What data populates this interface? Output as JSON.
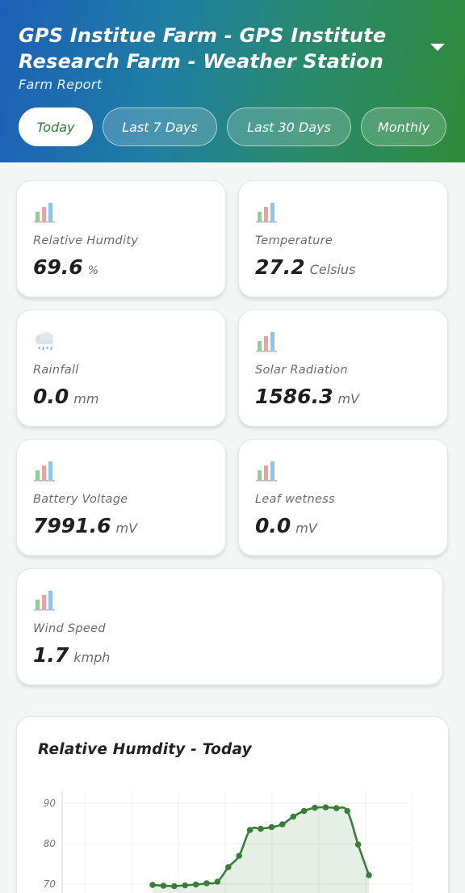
{
  "header": {
    "title": "GPS Institue Farm - GPS Institute Research Farm - Weather Station",
    "subtitle": "Farm Report",
    "dropdown_icon": "caret-down-icon"
  },
  "tabs": [
    {
      "label": "Today",
      "active": true
    },
    {
      "label": "Last 7 Days",
      "active": false
    },
    {
      "label": "Last 30 Days",
      "active": false
    },
    {
      "label": "Monthly",
      "active": false
    }
  ],
  "metrics": {
    "humidity": {
      "label": "Relative Humdity",
      "value": "69.6",
      "unit": "%",
      "icon": "bar-chart-icon"
    },
    "temperature": {
      "label": "Temperature",
      "value": "27.2",
      "unit": "Celsius",
      "icon": "bar-chart-icon"
    },
    "rainfall": {
      "label": "Rainfall",
      "value": "0.0",
      "unit": "mm",
      "icon": "rain-cloud-icon"
    },
    "solar": {
      "label": "Solar Radiation",
      "value": "1586.3",
      "unit": "mV",
      "icon": "bar-chart-icon"
    },
    "battery": {
      "label": "Battery Voltage",
      "value": "7991.6",
      "unit": "mV",
      "icon": "bar-chart-icon"
    },
    "leaf": {
      "label": "Leaf wetness",
      "value": "0.0",
      "unit": "mV",
      "icon": "bar-chart-icon"
    },
    "wind": {
      "label": "Wind Speed",
      "value": "1.7",
      "unit": "kmph",
      "icon": "bar-chart-icon"
    }
  },
  "colors": {
    "accent_green": "#2e7d32",
    "header_blue": "#1c5fb8",
    "header_green": "#2e8b3a"
  },
  "chart_data": {
    "type": "line",
    "title": "Relative Humdity - Today",
    "xlabel": "",
    "ylabel": "",
    "yticks": [
      70,
      80,
      90
    ],
    "ylim": [
      66,
      93
    ],
    "x": [
      0,
      1,
      2,
      3,
      4,
      5,
      6,
      7,
      8,
      9,
      10,
      11,
      12,
      13,
      14,
      15,
      16,
      17,
      18,
      19,
      20
    ],
    "series": [
      {
        "values": [
          69.8,
          69.6,
          69.5,
          69.7,
          69.9,
          70.2,
          70.6,
          74.2,
          77.0,
          83.4,
          83.7,
          84.1,
          84.8,
          86.7,
          88.1,
          88.9,
          89.0,
          88.8,
          88.1,
          79.8,
          72.2
        ]
      }
    ],
    "grid": true
  }
}
